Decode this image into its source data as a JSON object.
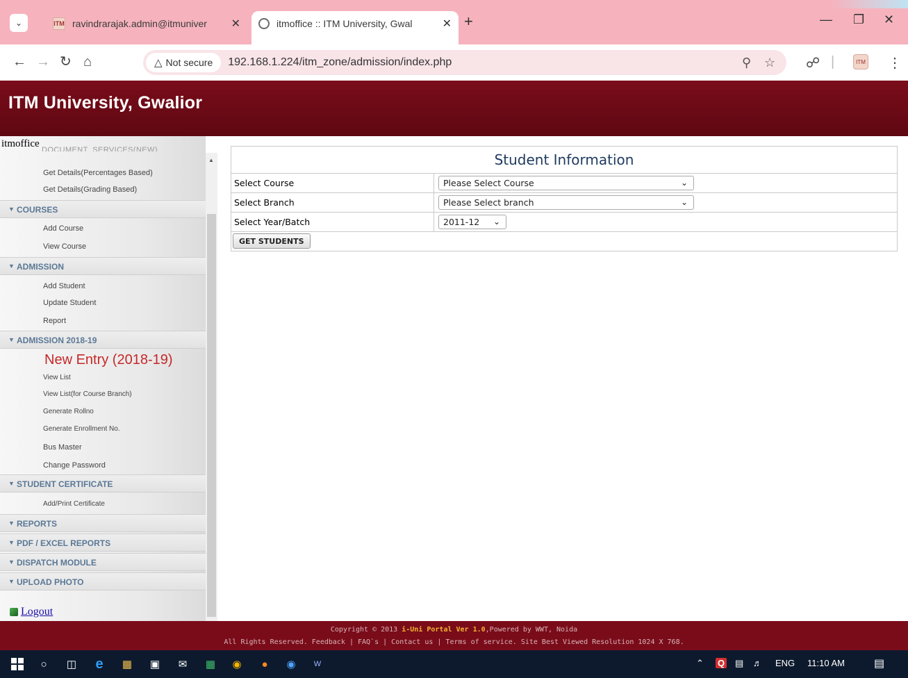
{
  "browser": {
    "tabs": [
      {
        "title": "ravindrarajak.admin@itmuniver",
        "favicon": "itm-favicon",
        "active": false
      },
      {
        "title": "itmoffice :: ITM University, Gwal",
        "favicon": "globe-icon",
        "active": true
      }
    ],
    "security_label": "Not secure",
    "url": "192.168.1.224/itm_zone/admission/index.php",
    "colors": {
      "tabstrip": "#f6b3bd",
      "omnibox": "#f9e4e8"
    }
  },
  "header": {
    "site_title": "ITM University, Gwalior",
    "color": "#7a0c1a"
  },
  "sidebar": {
    "user_label": "itmoffice",
    "cut_item": "DOCUMENT_SERVICES(NEW)",
    "groups": {
      "pre_items": [
        "Get Details(Percentages Based)",
        "Get Details(Grading Based)"
      ],
      "courses": {
        "title": "COURSES",
        "items": [
          "Add Course",
          "View Course"
        ]
      },
      "admission": {
        "title": "ADMISSION",
        "items": [
          "Add Student",
          "Update Student",
          "Report"
        ]
      },
      "admission_2018": {
        "title": "ADMISSION 2018-19",
        "highlight": "New Entry (2018-19)",
        "items": [
          "View List",
          "View List(for Course Branch)",
          "Generate Rollno",
          "Generate Enrollment No.",
          "Bus Master",
          "Change Password"
        ]
      },
      "student_certificate": {
        "title": "STUDENT CERTIFICATE",
        "items": [
          "Add/Print Certificate"
        ]
      },
      "reports": {
        "title": "REPORTS"
      },
      "pdf_excel": {
        "title": "PDF / EXCEL REPORTS"
      },
      "dispatch": {
        "title": "DISPATCH MODULE"
      },
      "upload_photo": {
        "title": "UPLOAD PHOTO"
      }
    },
    "logout": "Logout"
  },
  "form": {
    "title": "Student Information",
    "rows": [
      {
        "label": "Select Course",
        "value": "Please Select Course"
      },
      {
        "label": "Select Branch",
        "value": "Please Select branch"
      },
      {
        "label": "Select Year/Batch",
        "value": "2011-12"
      }
    ],
    "submit_label": "GET STUDENTS"
  },
  "footer": {
    "line1_prefix": "Copyright © 2013 ",
    "line1_brand": "i-Uni Portal Ver 1.0",
    "line1_suffix": ",Powered by WWT, Noida",
    "line2": "All Rights Reserved. Feedback | FAQ`s | Contact us | Terms of service. Site Best Viewed Resolution 1024 X 768."
  },
  "taskbar": {
    "language": "ENG",
    "time": "11:10 AM"
  }
}
